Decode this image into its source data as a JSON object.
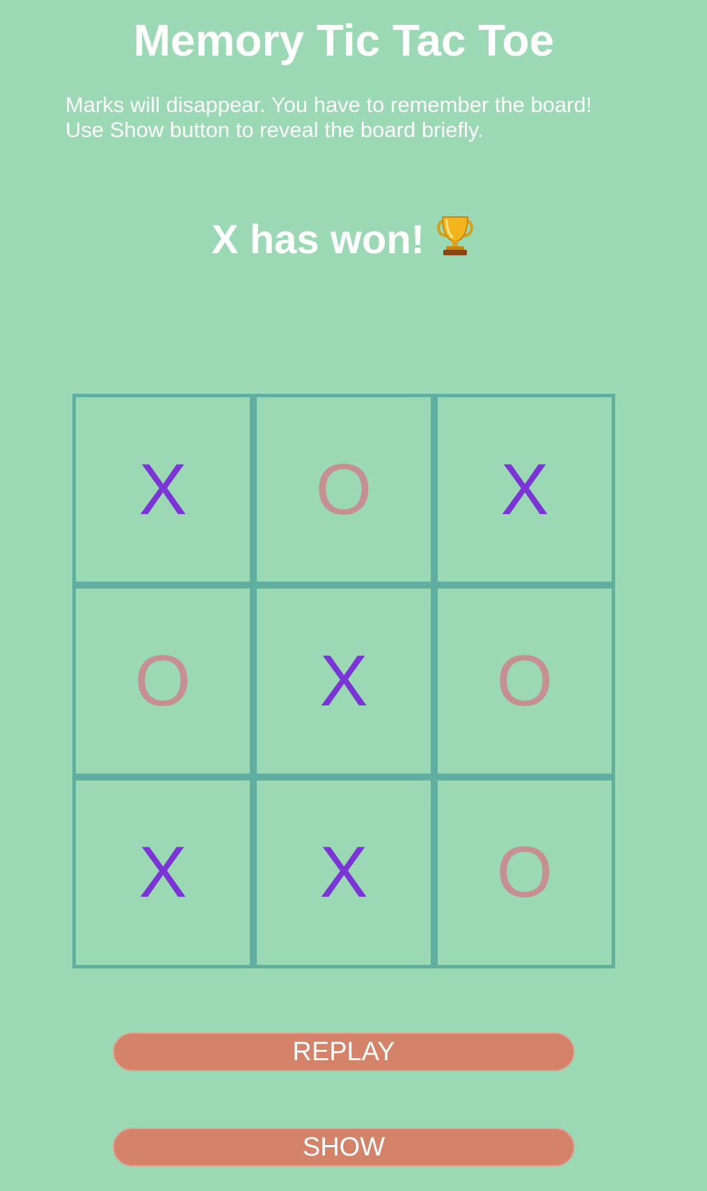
{
  "header": {
    "title": "Memory Tic Tac Toe",
    "instructions_line1": "Marks will disappear. You have to remember the board!",
    "instructions_line2": "Use Show button to reveal the board briefly."
  },
  "status": {
    "text": "X has won!",
    "icon": "trophy-icon"
  },
  "board": {
    "cells": [
      "X",
      "O",
      "X",
      "O",
      "X",
      "O",
      "X",
      "X",
      "O"
    ],
    "x_color": "#7b35d6",
    "o_color": "#c58f93"
  },
  "buttons": {
    "replay_label": "REPLAY",
    "show_label": "SHOW"
  },
  "colors": {
    "background": "#9bd9b4",
    "grid": "#60aea0",
    "button": "#d58368"
  }
}
